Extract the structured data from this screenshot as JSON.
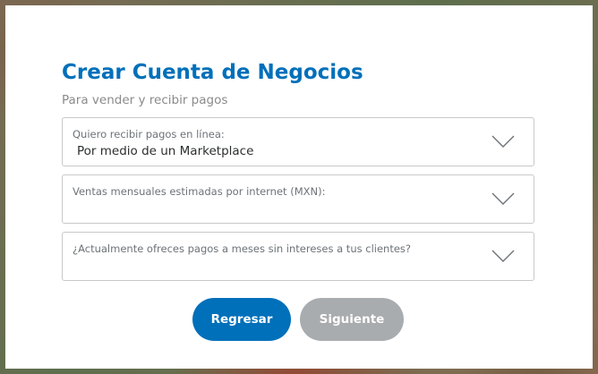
{
  "form": {
    "title": "Crear Cuenta de Negocios",
    "subtitle": "Para vender y recibir pagos",
    "fields": [
      {
        "label": "Quiero recibir pagos en línea:",
        "value": "Por medio de un Marketplace"
      },
      {
        "label": "Ventas mensuales estimadas por internet (MXN):",
        "value": ""
      },
      {
        "label": "¿Actualmente ofreces pagos a meses sin intereses a tus clientes?",
        "value": ""
      }
    ],
    "buttons": {
      "back_label": "Regresar",
      "next_label": "Siguiente"
    }
  },
  "colors": {
    "accent": "#0070ba",
    "disabled_button": "#a9acae",
    "label_text": "#6c7378",
    "border": "#c9c9c9"
  },
  "icons": {
    "dropdown": "chevron-down-icon"
  }
}
